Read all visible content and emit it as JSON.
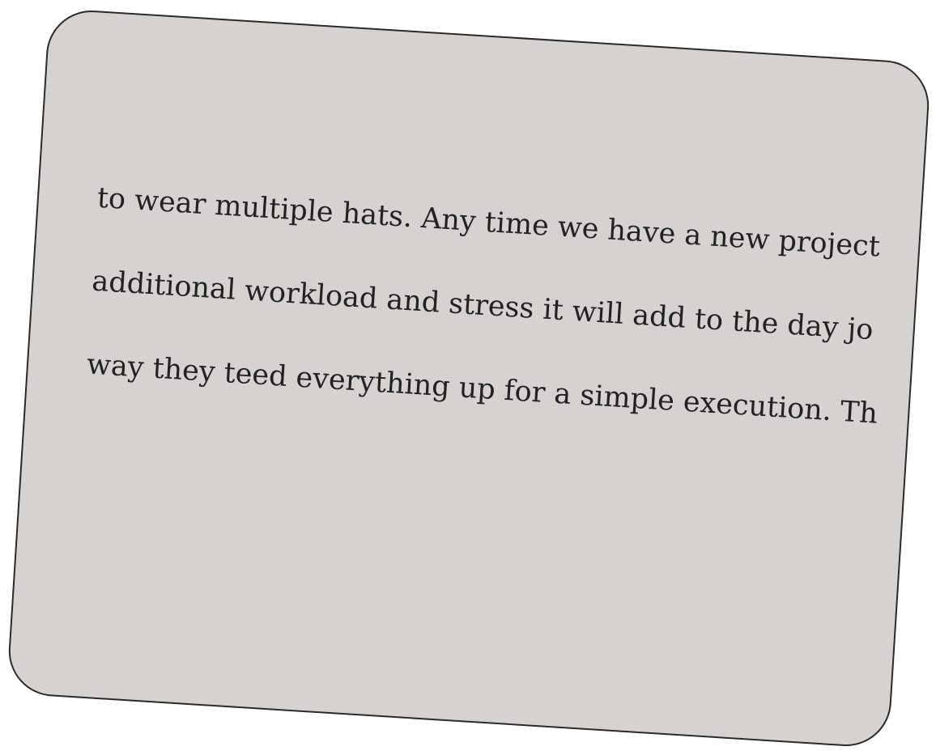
{
  "card": {
    "background": "#d5d2cf",
    "border_color": "#2a2a2a",
    "text_color": "#222222"
  },
  "lines": [
    "to wear multiple hats. Any time we have a new project",
    "additional workload and stress it will add to the day jo",
    "way they teed everything up for a simple execution. Th"
  ]
}
